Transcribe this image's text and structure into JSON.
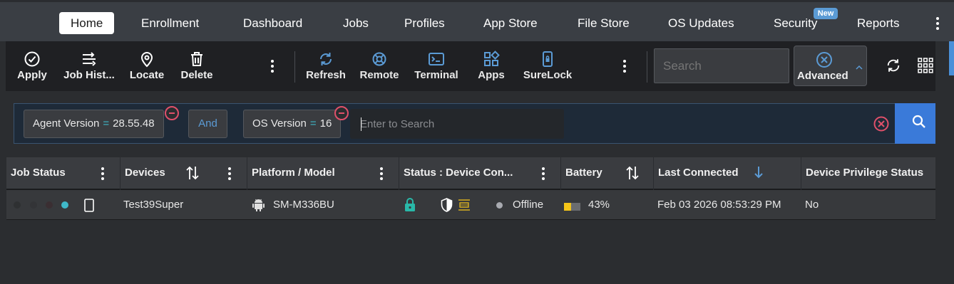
{
  "nav": {
    "items": [
      "Home",
      "Enrollment",
      "Dashboard",
      "Jobs",
      "Profiles",
      "App Store",
      "File Store",
      "OS Updates",
      "Security",
      "Reports"
    ],
    "active": "Home",
    "security_badge": "New"
  },
  "toolbar": {
    "apply": "Apply",
    "job_history": "Job Hist...",
    "locate": "Locate",
    "delete": "Delete",
    "refresh": "Refresh",
    "remote": "Remote",
    "terminal": "Terminal",
    "apps": "Apps",
    "surelock": "SureLock",
    "search_placeholder": "Search",
    "advanced": "Advanced"
  },
  "filter": {
    "chips": [
      {
        "field": "Agent Version",
        "op": "=",
        "value": "28.55.48"
      },
      {
        "field": "OS Version",
        "op": "=",
        "value": "16"
      }
    ],
    "join": "And",
    "input_placeholder": "Enter to Search"
  },
  "table": {
    "columns": [
      "Job Status",
      "Devices",
      "Platform / Model",
      "Status : Device Con...",
      "Battery",
      "Last Connected",
      "Device Privilege Status"
    ],
    "rows": [
      {
        "device": "Test39Super",
        "model": "SM-M336BU",
        "status": "Offline",
        "battery": "43%",
        "battery_level": 0.43,
        "last_connected": "Feb 03 2026 08:53:29 PM",
        "privilege": "No"
      }
    ]
  },
  "colors": {
    "accent": "#3a7ad9",
    "icon_blue": "#5b9bd5",
    "online_teal": "#3fb8c8",
    "lock_teal": "#29b8a8",
    "battery_yellow": "#f5c518",
    "remove_red": "#e0506a"
  }
}
